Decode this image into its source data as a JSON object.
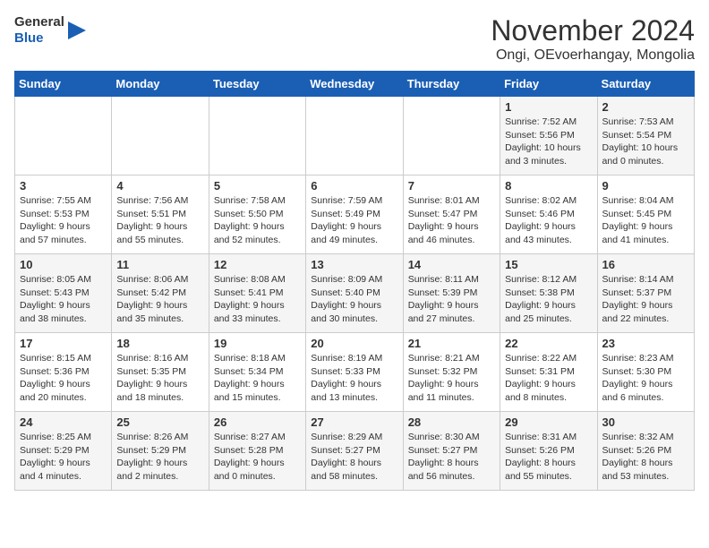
{
  "header": {
    "logo_line1": "General",
    "logo_line2": "Blue",
    "month": "November 2024",
    "location": "Ongi, OEvoerhangay, Mongolia"
  },
  "weekdays": [
    "Sunday",
    "Monday",
    "Tuesday",
    "Wednesday",
    "Thursday",
    "Friday",
    "Saturday"
  ],
  "weeks": [
    [
      {
        "day": "",
        "detail": ""
      },
      {
        "day": "",
        "detail": ""
      },
      {
        "day": "",
        "detail": ""
      },
      {
        "day": "",
        "detail": ""
      },
      {
        "day": "",
        "detail": ""
      },
      {
        "day": "1",
        "detail": "Sunrise: 7:52 AM\nSunset: 5:56 PM\nDaylight: 10 hours\nand 3 minutes."
      },
      {
        "day": "2",
        "detail": "Sunrise: 7:53 AM\nSunset: 5:54 PM\nDaylight: 10 hours\nand 0 minutes."
      }
    ],
    [
      {
        "day": "3",
        "detail": "Sunrise: 7:55 AM\nSunset: 5:53 PM\nDaylight: 9 hours\nand 57 minutes."
      },
      {
        "day": "4",
        "detail": "Sunrise: 7:56 AM\nSunset: 5:51 PM\nDaylight: 9 hours\nand 55 minutes."
      },
      {
        "day": "5",
        "detail": "Sunrise: 7:58 AM\nSunset: 5:50 PM\nDaylight: 9 hours\nand 52 minutes."
      },
      {
        "day": "6",
        "detail": "Sunrise: 7:59 AM\nSunset: 5:49 PM\nDaylight: 9 hours\nand 49 minutes."
      },
      {
        "day": "7",
        "detail": "Sunrise: 8:01 AM\nSunset: 5:47 PM\nDaylight: 9 hours\nand 46 minutes."
      },
      {
        "day": "8",
        "detail": "Sunrise: 8:02 AM\nSunset: 5:46 PM\nDaylight: 9 hours\nand 43 minutes."
      },
      {
        "day": "9",
        "detail": "Sunrise: 8:04 AM\nSunset: 5:45 PM\nDaylight: 9 hours\nand 41 minutes."
      }
    ],
    [
      {
        "day": "10",
        "detail": "Sunrise: 8:05 AM\nSunset: 5:43 PM\nDaylight: 9 hours\nand 38 minutes."
      },
      {
        "day": "11",
        "detail": "Sunrise: 8:06 AM\nSunset: 5:42 PM\nDaylight: 9 hours\nand 35 minutes."
      },
      {
        "day": "12",
        "detail": "Sunrise: 8:08 AM\nSunset: 5:41 PM\nDaylight: 9 hours\nand 33 minutes."
      },
      {
        "day": "13",
        "detail": "Sunrise: 8:09 AM\nSunset: 5:40 PM\nDaylight: 9 hours\nand 30 minutes."
      },
      {
        "day": "14",
        "detail": "Sunrise: 8:11 AM\nSunset: 5:39 PM\nDaylight: 9 hours\nand 27 minutes."
      },
      {
        "day": "15",
        "detail": "Sunrise: 8:12 AM\nSunset: 5:38 PM\nDaylight: 9 hours\nand 25 minutes."
      },
      {
        "day": "16",
        "detail": "Sunrise: 8:14 AM\nSunset: 5:37 PM\nDaylight: 9 hours\nand 22 minutes."
      }
    ],
    [
      {
        "day": "17",
        "detail": "Sunrise: 8:15 AM\nSunset: 5:36 PM\nDaylight: 9 hours\nand 20 minutes."
      },
      {
        "day": "18",
        "detail": "Sunrise: 8:16 AM\nSunset: 5:35 PM\nDaylight: 9 hours\nand 18 minutes."
      },
      {
        "day": "19",
        "detail": "Sunrise: 8:18 AM\nSunset: 5:34 PM\nDaylight: 9 hours\nand 15 minutes."
      },
      {
        "day": "20",
        "detail": "Sunrise: 8:19 AM\nSunset: 5:33 PM\nDaylight: 9 hours\nand 13 minutes."
      },
      {
        "day": "21",
        "detail": "Sunrise: 8:21 AM\nSunset: 5:32 PM\nDaylight: 9 hours\nand 11 minutes."
      },
      {
        "day": "22",
        "detail": "Sunrise: 8:22 AM\nSunset: 5:31 PM\nDaylight: 9 hours\nand 8 minutes."
      },
      {
        "day": "23",
        "detail": "Sunrise: 8:23 AM\nSunset: 5:30 PM\nDaylight: 9 hours\nand 6 minutes."
      }
    ],
    [
      {
        "day": "24",
        "detail": "Sunrise: 8:25 AM\nSunset: 5:29 PM\nDaylight: 9 hours\nand 4 minutes."
      },
      {
        "day": "25",
        "detail": "Sunrise: 8:26 AM\nSunset: 5:29 PM\nDaylight: 9 hours\nand 2 minutes."
      },
      {
        "day": "26",
        "detail": "Sunrise: 8:27 AM\nSunset: 5:28 PM\nDaylight: 9 hours\nand 0 minutes."
      },
      {
        "day": "27",
        "detail": "Sunrise: 8:29 AM\nSunset: 5:27 PM\nDaylight: 8 hours\nand 58 minutes."
      },
      {
        "day": "28",
        "detail": "Sunrise: 8:30 AM\nSunset: 5:27 PM\nDaylight: 8 hours\nand 56 minutes."
      },
      {
        "day": "29",
        "detail": "Sunrise: 8:31 AM\nSunset: 5:26 PM\nDaylight: 8 hours\nand 55 minutes."
      },
      {
        "day": "30",
        "detail": "Sunrise: 8:32 AM\nSunset: 5:26 PM\nDaylight: 8 hours\nand 53 minutes."
      }
    ]
  ]
}
